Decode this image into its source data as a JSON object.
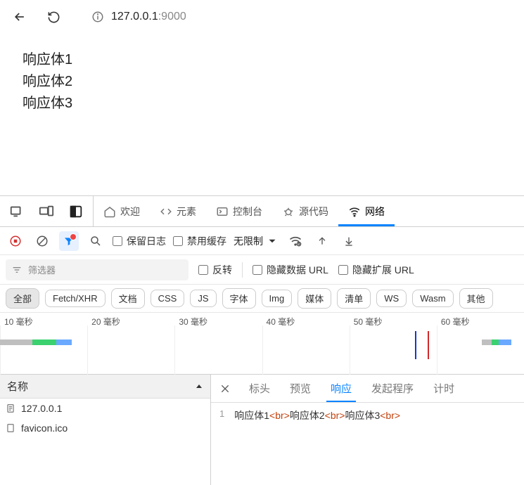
{
  "browser": {
    "url_host": "127.0.0.1",
    "url_port": ":9000"
  },
  "page_lines": [
    "响应体1",
    "响应体2",
    "响应体3"
  ],
  "devtools_tabs": {
    "welcome": "欢迎",
    "elements": "元素",
    "console": "控制台",
    "sources": "源代码",
    "network": "网络"
  },
  "net_toolbar": {
    "preserve_log": "保留日志",
    "disable_cache": "禁用缓存",
    "throttling": "无限制"
  },
  "filter_row": {
    "placeholder": "筛选器",
    "invert": "反转",
    "hide_data_urls": "隐藏数据 URL",
    "hide_ext_urls": "隐藏扩展 URL"
  },
  "type_pills": [
    "全部",
    "Fetch/XHR",
    "文档",
    "CSS",
    "JS",
    "字体",
    "Img",
    "媒体",
    "清单",
    "WS",
    "Wasm",
    "其他"
  ],
  "waterfall_ticks": [
    "10 毫秒",
    "20 毫秒",
    "30 毫秒",
    "40 毫秒",
    "50 毫秒",
    "60 毫秒"
  ],
  "requests": {
    "name_header": "名称",
    "items": [
      "127.0.0.1",
      "favicon.ico"
    ]
  },
  "detail_tabs": {
    "headers": "标头",
    "preview": "预览",
    "response": "响应",
    "initiator": "发起程序",
    "timing": "计时"
  },
  "response": {
    "line_no": "1",
    "seg1": "响应体1",
    "seg2": "响应体2",
    "seg3": "响应体3",
    "br": "<br>"
  }
}
